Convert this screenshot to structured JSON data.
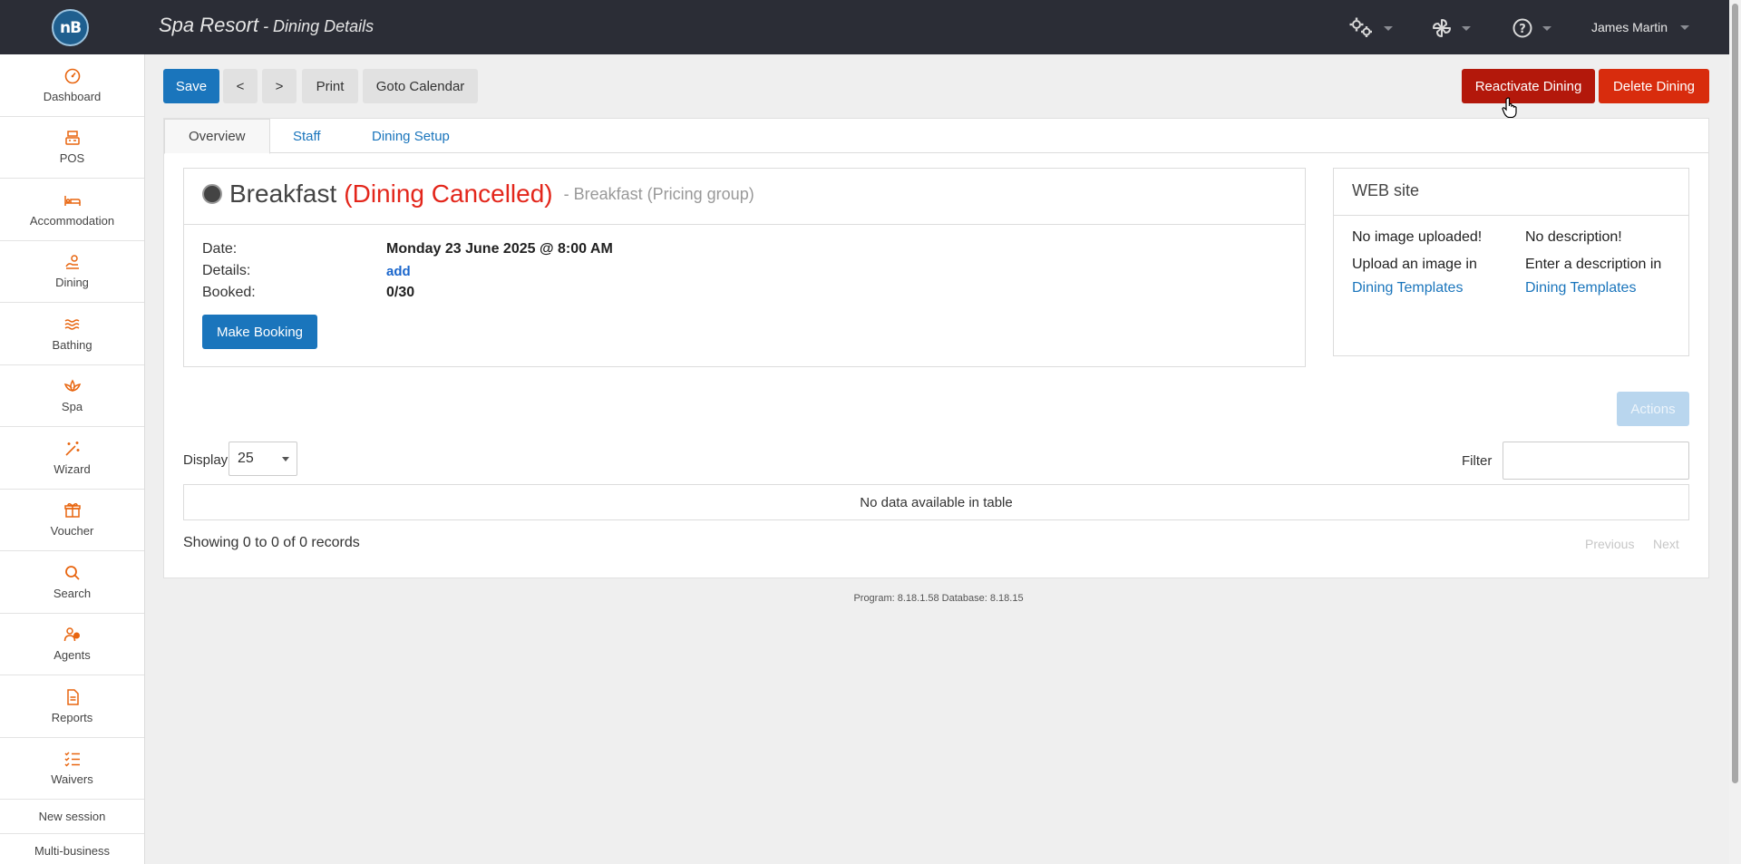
{
  "header": {
    "logo_text": "nB",
    "title": "Spa Resort",
    "subtitle": " - Dining Details",
    "user_name": "James Martin"
  },
  "sidebar": {
    "items": [
      {
        "label": "Dashboard",
        "icon": "dashboard-icon"
      },
      {
        "label": "POS",
        "icon": "cash-register-icon"
      },
      {
        "label": "Accommodation",
        "icon": "bed-icon"
      },
      {
        "label": "Dining",
        "icon": "dining-icon"
      },
      {
        "label": "Bathing",
        "icon": "water-waves-icon"
      },
      {
        "label": "Spa",
        "icon": "lotus-icon"
      },
      {
        "label": "Wizard",
        "icon": "magic-wand-icon"
      },
      {
        "label": "Voucher",
        "icon": "gift-icon"
      },
      {
        "label": "Search",
        "icon": "search-icon"
      },
      {
        "label": "Agents",
        "icon": "agents-icon"
      },
      {
        "label": "Reports",
        "icon": "report-document-icon"
      },
      {
        "label": "Waivers",
        "icon": "checklist-icon"
      }
    ],
    "new_session": "New session",
    "multi_business": "Multi-business"
  },
  "toolbar": {
    "save": "Save",
    "prev": "<",
    "next": ">",
    "print": "Print",
    "goto_calendar": "Goto Calendar",
    "reactivate": "Reactivate Dining",
    "delete": "Delete Dining"
  },
  "tabs": [
    "Overview",
    "Staff",
    "Dining Setup"
  ],
  "dining": {
    "name": "Breakfast",
    "status": "(Dining Cancelled)",
    "pricing_group": "- Breakfast (Pricing group)",
    "date_label": "Date:",
    "date_value": "Monday 23 June 2025 @ 8:00 AM",
    "details_label": "Details:",
    "details_value": "add",
    "booked_label": "Booked:",
    "booked_value": "0/30",
    "make_booking": "Make Booking"
  },
  "website": {
    "title": "WEB site",
    "no_image": "No image uploaded!",
    "upload_text": "Upload an image in",
    "upload_link": "Dining Templates",
    "no_description": "No description!",
    "desc_text": "Enter a description in",
    "desc_link": "Dining Templates"
  },
  "table": {
    "actions": "Actions",
    "display_label": "Display",
    "display_value": "25",
    "filter_label": "Filter",
    "empty": "No data available in table",
    "summary": "Showing 0 to 0 of 0 records",
    "previous": "Previous",
    "next": "Next"
  },
  "footer": {
    "version": "Program: 8.18.1.58 Database: 8.18.15"
  },
  "colors": {
    "topbar": "#2b2d36",
    "primary": "#1a75bc",
    "danger": "#d82c0d",
    "cancelled": "#e3261b",
    "icon_orange": "#e8650f"
  }
}
